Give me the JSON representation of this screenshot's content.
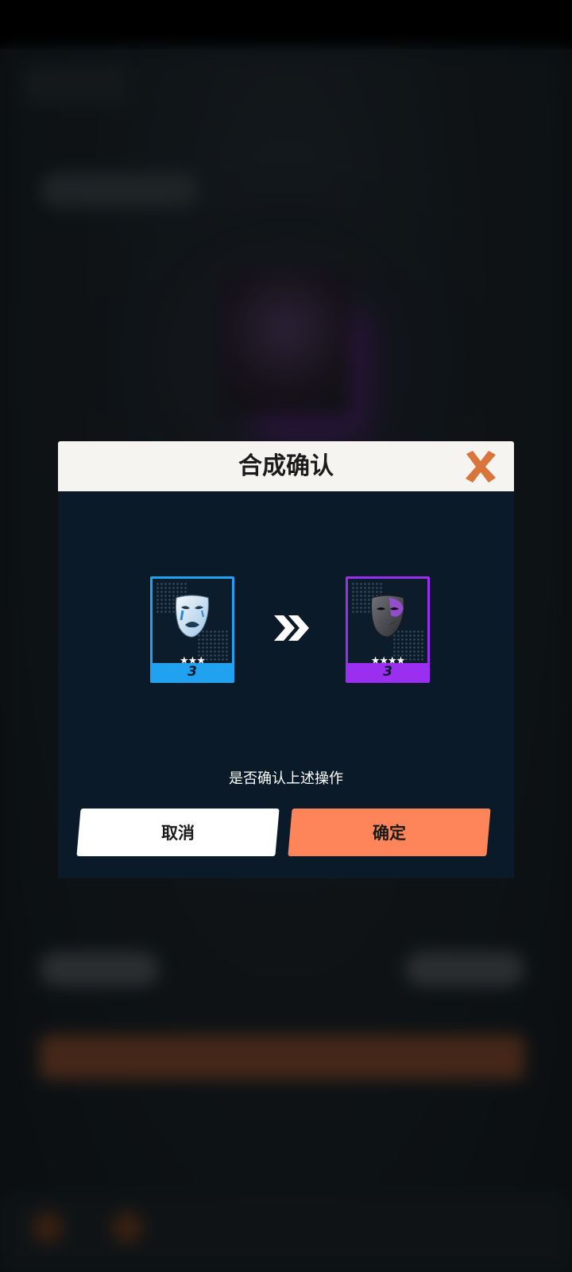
{
  "dialog": {
    "title": "合成确认",
    "prompt": "是否确认上述操作",
    "cancel_label": "取消",
    "confirm_label": "确定"
  },
  "source_item": {
    "stars": "★★★",
    "level": "3",
    "rarity_color": "#21a2f0",
    "icon": "crying-mask-icon"
  },
  "result_item": {
    "stars": "★★★★",
    "level": "3",
    "rarity_color": "#9a2ff0",
    "icon": "smiling-dark-mask-icon"
  },
  "colors": {
    "confirm_button": "#fd8559",
    "close_icon": "#d9743a",
    "dialog_body": "#0a1a28"
  }
}
